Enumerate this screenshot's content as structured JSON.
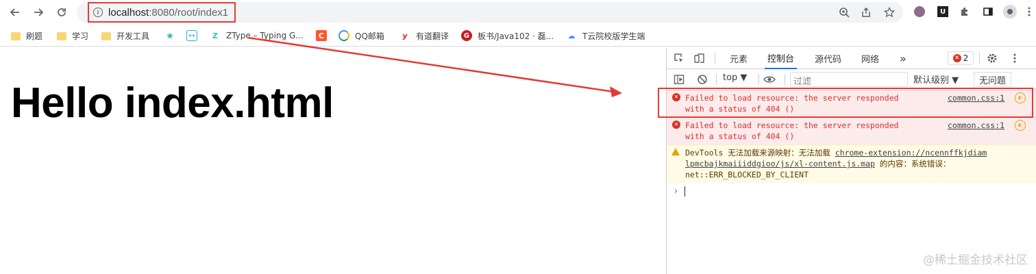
{
  "toolbar": {
    "url_host": "localhost",
    "url_path": ":8080/root/index1"
  },
  "bookmarks": [
    {
      "label": "刷题",
      "icon": "folder-icon"
    },
    {
      "label": "学习",
      "icon": "folder-icon"
    },
    {
      "label": "开发工具",
      "icon": "folder-icon"
    },
    {
      "label": "",
      "icon": "leaf-icon"
    },
    {
      "label": "",
      "icon": "bilibili-icon"
    },
    {
      "label": "ZType – Typing G...",
      "icon": "ztype-icon"
    },
    {
      "label": "",
      "icon": "csdn-icon"
    },
    {
      "label": "QQ邮箱",
      "icon": "qqmail-icon"
    },
    {
      "label": "有道翻译",
      "icon": "youdao-icon"
    },
    {
      "label": "板书/Java102 · 磊...",
      "icon": "gitee-icon"
    },
    {
      "label": "T云院校版学生端",
      "icon": "cloud-icon"
    }
  ],
  "page": {
    "heading": "Hello index.html"
  },
  "devtools": {
    "tabs": [
      "元素",
      "控制台",
      "源代码",
      "网络"
    ],
    "active_tab": "控制台",
    "more": "»",
    "error_count": "2",
    "context": "top ▼",
    "filter_placeholder": "过滤",
    "level": "默认级别 ▼",
    "issues": "无问题",
    "messages": [
      {
        "type": "error",
        "text": "Failed to load resource: the server responded\nwith a status of 404 ()",
        "source": "common.css:1"
      },
      {
        "type": "error",
        "text": "Failed to load resource: the server responded\nwith a status of 404 ()",
        "source": "common.css:1"
      },
      {
        "type": "warning",
        "text_before": "DevTools 无法加载来源映射：无法加载 ",
        "link": "chrome-extension://ncennffkjdiam\nlpmcbajkmaiiiddgioo/js/xl-content.js.map",
        "text_after": " 的内容：系统错误：\nnet::ERR_BLOCKED_BY_CLIENT"
      }
    ],
    "prompt": "›"
  },
  "watermark": "@稀土掘金技术社区",
  "colors": {
    "annotation": "#e53935",
    "error_text": "#e02d2d",
    "error_bg": "#fcebeb",
    "warn_bg": "#fffbe6",
    "accent": "#1a73e8"
  }
}
